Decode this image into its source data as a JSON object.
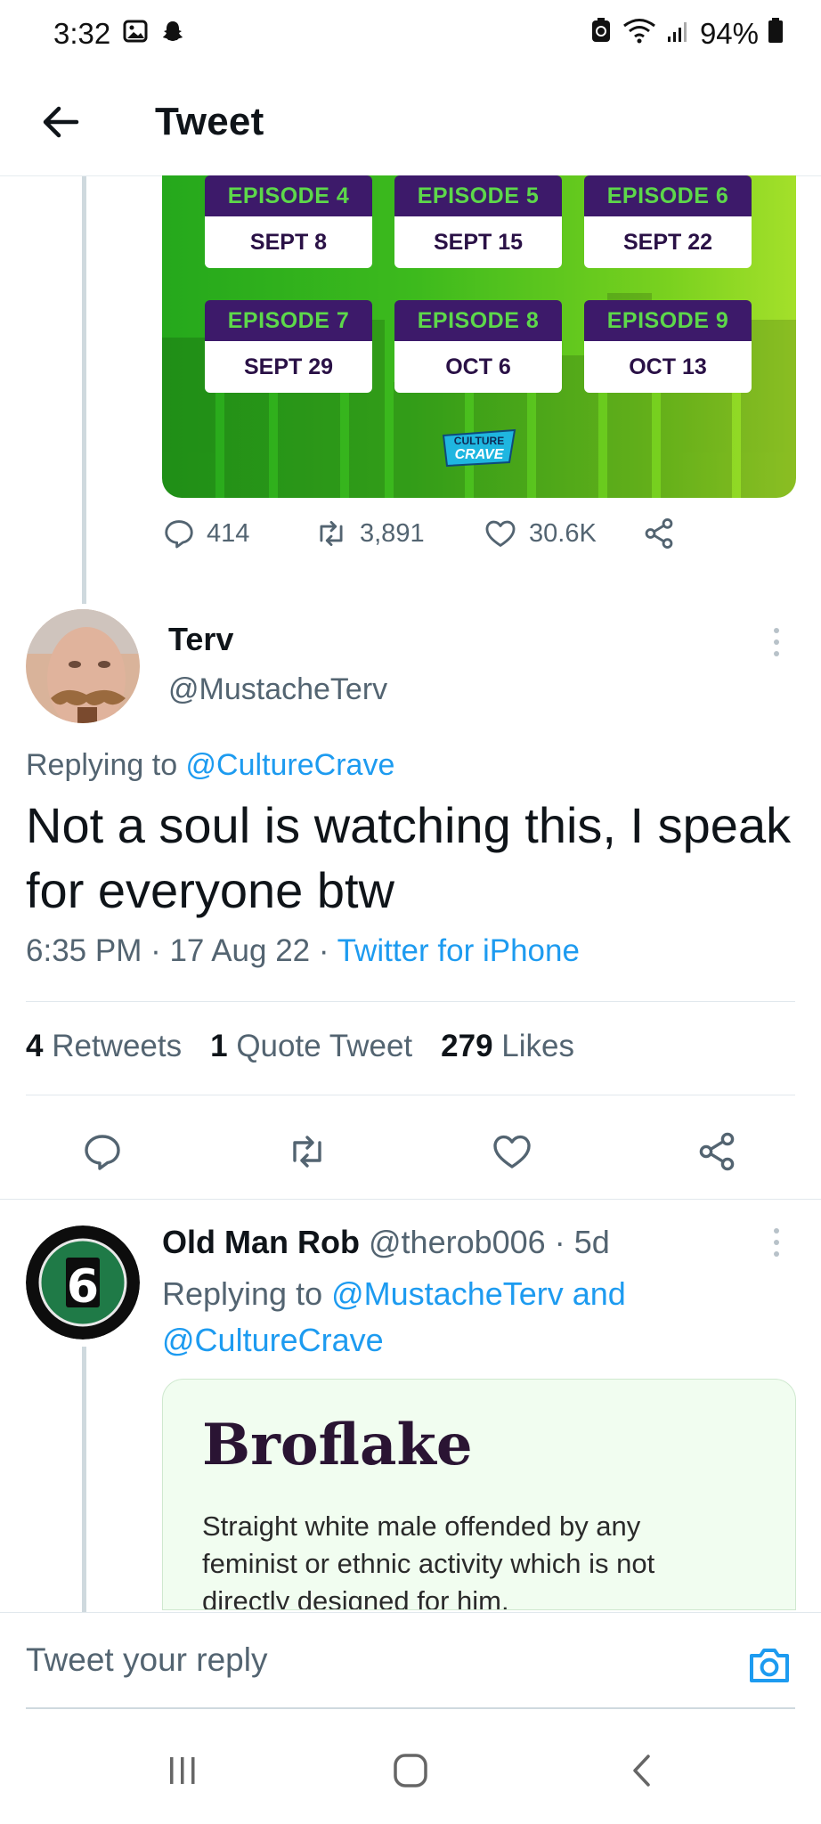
{
  "status_bar": {
    "time": "3:32",
    "battery": "94%",
    "icons": [
      "gallery-icon",
      "snapchat-icon",
      "battery-saver-icon",
      "wifi-icon",
      "signal-icon",
      "battery-icon"
    ]
  },
  "header": {
    "title": "Tweet",
    "back_icon": "arrow-left-icon"
  },
  "media": {
    "episodes": [
      {
        "episode": "EPISODE 4",
        "date": "SEPT 8"
      },
      {
        "episode": "EPISODE 5",
        "date": "SEPT 15"
      },
      {
        "episode": "EPISODE 6",
        "date": "SEPT 22"
      },
      {
        "episode": "EPISODE 7",
        "date": "SEPT 29"
      },
      {
        "episode": "EPISODE 8",
        "date": "OCT 6"
      },
      {
        "episode": "EPISODE 9",
        "date": "OCT 13"
      }
    ],
    "logo_text_1": "CULTURE",
    "logo_text_2": "CRAVE",
    "colors": {
      "tile_top": "#3d1a6a",
      "tile_top_text": "#5dd84a",
      "tile_bottom_text": "#2a1146"
    }
  },
  "media_actions": {
    "replies": "414",
    "retweets": "3,891",
    "likes": "30.6K"
  },
  "main_tweet": {
    "name": "Terv",
    "handle": "@MustacheTerv",
    "replying_prefix": "Replying to ",
    "replying_to": "@CultureCrave",
    "text": "Not a soul is watching this, I speak for everyone btw",
    "time": "6:35 PM",
    "date": "17 Aug 22",
    "sep": " · ",
    "source": "Twitter for iPhone",
    "stats": {
      "retweets_count": "4",
      "retweets_label": "Retweets",
      "quotes_count": "1",
      "quotes_label": "Quote Tweet",
      "likes_count": "279",
      "likes_label": "Likes"
    }
  },
  "reply_tweet": {
    "name": "Old Man Rob",
    "handle": "@therob006",
    "age": "5d",
    "sep": " · ",
    "replying_prefix": "Replying to ",
    "replying_to_1": "@MustacheTerv",
    "and": " and ",
    "replying_to_2": "@CultureCrave",
    "avatar_number": "6",
    "card": {
      "title": "Broflake",
      "body": "Straight white male offended by any feminist or ethnic activity which is not directly designed for him."
    }
  },
  "reply_box": {
    "placeholder": "Tweet your reply"
  },
  "accent_color": "#1d9bf0"
}
